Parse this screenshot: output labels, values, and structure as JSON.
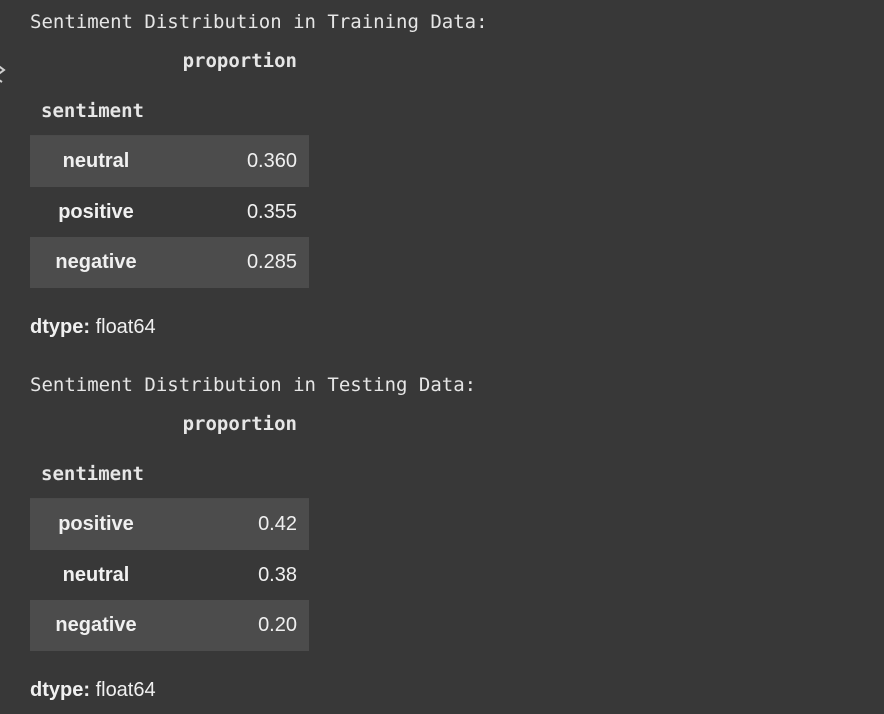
{
  "outputs": [
    {
      "print_text": "Sentiment Distribution in Training Data:",
      "column_header": "proportion",
      "index_name": "sentiment",
      "rows": [
        {
          "label": "neutral",
          "value": "0.360"
        },
        {
          "label": "positive",
          "value": "0.355"
        },
        {
          "label": "negative",
          "value": "0.285"
        }
      ],
      "dtype_label": "dtype:",
      "dtype_value": "float64"
    },
    {
      "print_text": "Sentiment Distribution in Testing Data:",
      "column_header": "proportion",
      "index_name": "sentiment",
      "rows": [
        {
          "label": "positive",
          "value": "0.42"
        },
        {
          "label": "neutral",
          "value": "0.38"
        },
        {
          "label": "negative",
          "value": "0.20"
        }
      ],
      "dtype_label": "dtype:",
      "dtype_value": "float64"
    }
  ],
  "colors": {
    "background": "#383838",
    "row_stripe": "#4c4c4c",
    "text": "#e6e6e6"
  },
  "icons": {
    "gutter": "output-collapse-icon"
  }
}
